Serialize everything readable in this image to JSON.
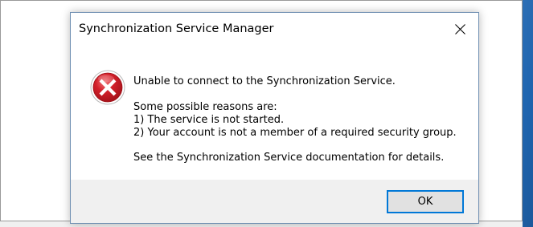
{
  "dialog": {
    "title": "Synchronization Service Manager",
    "close_icon": "close-icon",
    "icon": "error-icon",
    "message": {
      "line1": "Unable to connect to the Synchronization Service.",
      "line2": "Some possible reasons are:",
      "line3": "1) The service is not started.",
      "line4": "2) Your account is not a member of a required security group.",
      "line5": "See the Synchronization Service documentation for details."
    },
    "ok_label": "OK"
  },
  "colors": {
    "error_red": "#d3202a",
    "button_border_focus": "#0078d7",
    "footer_bg": "#f0f0f0",
    "desktop_blue": "#1d6fc0"
  }
}
